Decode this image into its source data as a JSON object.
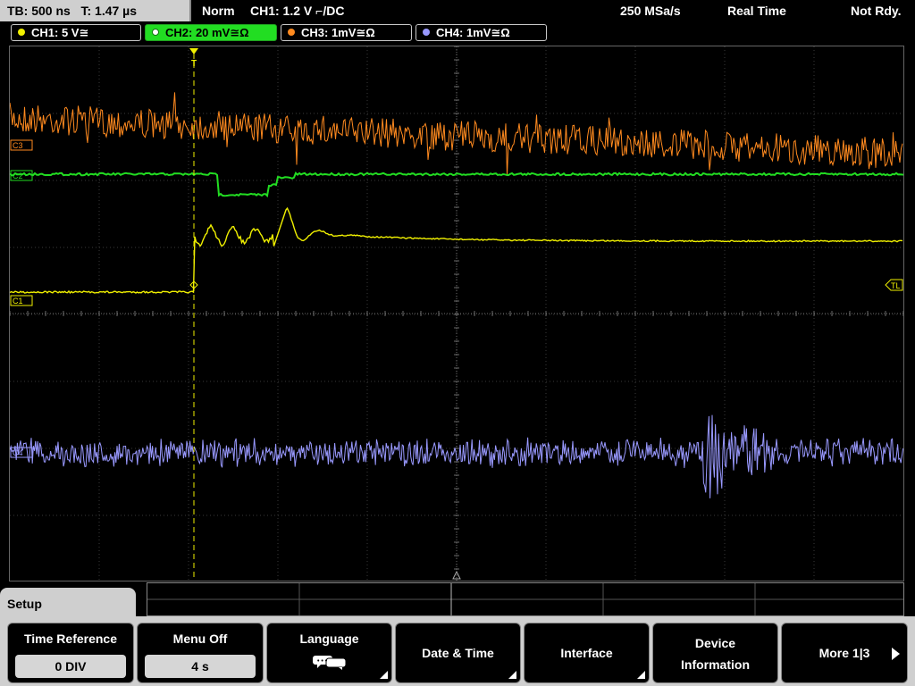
{
  "status": {
    "timebase": "TB: 500 ns",
    "trigger_time": "T: 1.47 µs",
    "mode": "Norm",
    "trigger": "CH1: 1.2 V ⌐/DC",
    "sample_rate": "250 MSa/s",
    "acq_mode": "Real Time",
    "state": "Not Rdy."
  },
  "channels": [
    {
      "label": "CH1: 5 V≅",
      "color": "#f0f000"
    },
    {
      "label": "CH2: 20 mV≅Ω",
      "color": "#22dd22"
    },
    {
      "label": "CH3: 1mV≅Ω",
      "color": "#ff8a1f"
    },
    {
      "label": "CH4: 1mV≅Ω",
      "color": "#9999ff"
    }
  ],
  "screen": {
    "markers": {
      "c3": "C3",
      "c2": "C2",
      "c1": "C1",
      "c4": "C4",
      "trigger_level": "TL",
      "trigger_pos": "T"
    }
  },
  "menu": {
    "title": "Setup",
    "softkeys": {
      "time_reference": {
        "label": "Time Reference",
        "value": "0 DIV"
      },
      "menu_off": {
        "label": "Menu Off",
        "value": "4 s"
      },
      "language": {
        "label": "Language",
        "icon": "speech-bubbles-icon"
      },
      "date_time": {
        "label": "Date & Time"
      },
      "interface": {
        "label": "Interface"
      },
      "device_information": {
        "line1": "Device",
        "line2": "Information"
      },
      "more": {
        "label": "More 1|3"
      }
    }
  }
}
